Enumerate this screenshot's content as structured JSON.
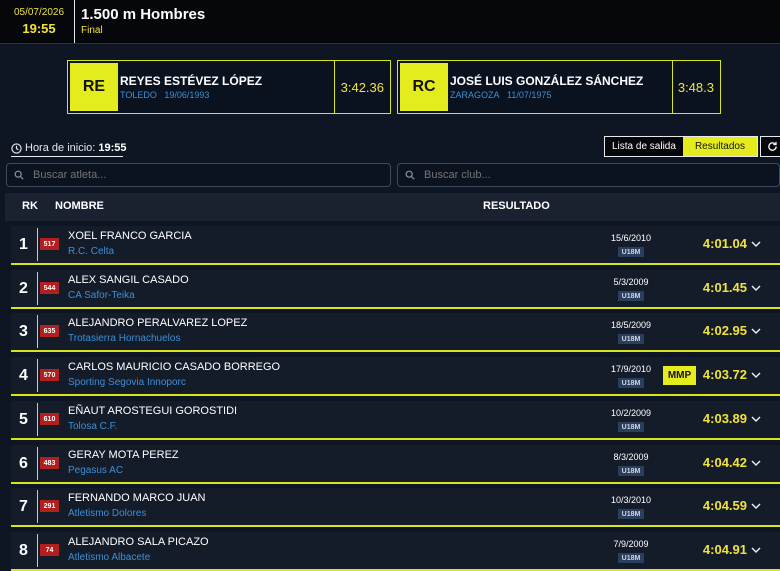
{
  "header": {
    "date": "05/07/2026",
    "time": "19:55",
    "event_title": "1.500 m Hombres",
    "event_sub": "Final"
  },
  "records": [
    {
      "abbr": "RE",
      "name": "REYES ESTÉVEZ LÓPEZ",
      "place": "TOLEDO",
      "date": "19/06/1993",
      "time": "3:42.36"
    },
    {
      "abbr": "RC",
      "name": "JOSÉ LUIS GONZÁLEZ SÁNCHEZ",
      "place": "ZARAGOZA",
      "date": "11/07/1975",
      "time": "3:48.3"
    }
  ],
  "start": {
    "label": "Hora de inicio:",
    "value": "19:55"
  },
  "tabs": {
    "startlist": "Lista de salida",
    "results": "Resultados"
  },
  "search": {
    "athlete_placeholder": "Buscar atleta...",
    "club_placeholder": "Buscar club..."
  },
  "table": {
    "headers": {
      "rk": "RK",
      "name": "NOMBRE",
      "result": "RESULTADO"
    },
    "rows": [
      {
        "rk": "1",
        "bib": "517",
        "name": "XOEL FRANCO GARCIA",
        "club": "R.C. Celta",
        "birth": "15/6/2010",
        "cat": "U18M",
        "badge": "",
        "result": "4:01.04"
      },
      {
        "rk": "2",
        "bib": "544",
        "name": "ALEX SANGIL CASADO",
        "club": "CA Safor-Teika",
        "birth": "5/3/2009",
        "cat": "U18M",
        "badge": "",
        "result": "4:01.45"
      },
      {
        "rk": "3",
        "bib": "635",
        "name": "ALEJANDRO PERALVAREZ LOPEZ",
        "club": "Trotasierra Hornachuelos",
        "birth": "18/5/2009",
        "cat": "U18M",
        "badge": "",
        "result": "4:02.95"
      },
      {
        "rk": "4",
        "bib": "570",
        "name": "CARLOS MAURICIO CASADO BORREGO",
        "club": "Sporting Segovia Innoporc",
        "birth": "17/9/2010",
        "cat": "U18M",
        "badge": "MMP",
        "result": "4:03.72"
      },
      {
        "rk": "5",
        "bib": "610",
        "name": "EÑAUT AROSTEGUI GOROSTIDI",
        "club": "Tolosa C.F.",
        "birth": "10/2/2009",
        "cat": "U18M",
        "badge": "",
        "result": "4:03.89"
      },
      {
        "rk": "6",
        "bib": "483",
        "name": "GERAY MOTA PEREZ",
        "club": "Pegasus AC",
        "birth": "8/3/2009",
        "cat": "U18M",
        "badge": "",
        "result": "4:04.42"
      },
      {
        "rk": "7",
        "bib": "291",
        "name": "FERNANDO MARCO JUAN",
        "club": "Atletismo Dolores",
        "birth": "10/3/2010",
        "cat": "U18M",
        "badge": "",
        "result": "4:04.59"
      },
      {
        "rk": "8",
        "bib": "74",
        "name": "ALEJANDRO SALA PICAZO",
        "club": "Atletismo Albacete",
        "birth": "7/9/2009",
        "cat": "U18M",
        "badge": "",
        "result": "4:04.91"
      }
    ]
  },
  "colors": {
    "accent": "#e4ec1d",
    "result": "#f2e33a",
    "club": "#3d8fd6",
    "bib": "#b11f1f",
    "background": "#0f1623"
  },
  "icons": {
    "clock": "clock-icon",
    "refresh": "refresh-icon",
    "search": "search-icon",
    "expand": "chevron-down-icon"
  }
}
